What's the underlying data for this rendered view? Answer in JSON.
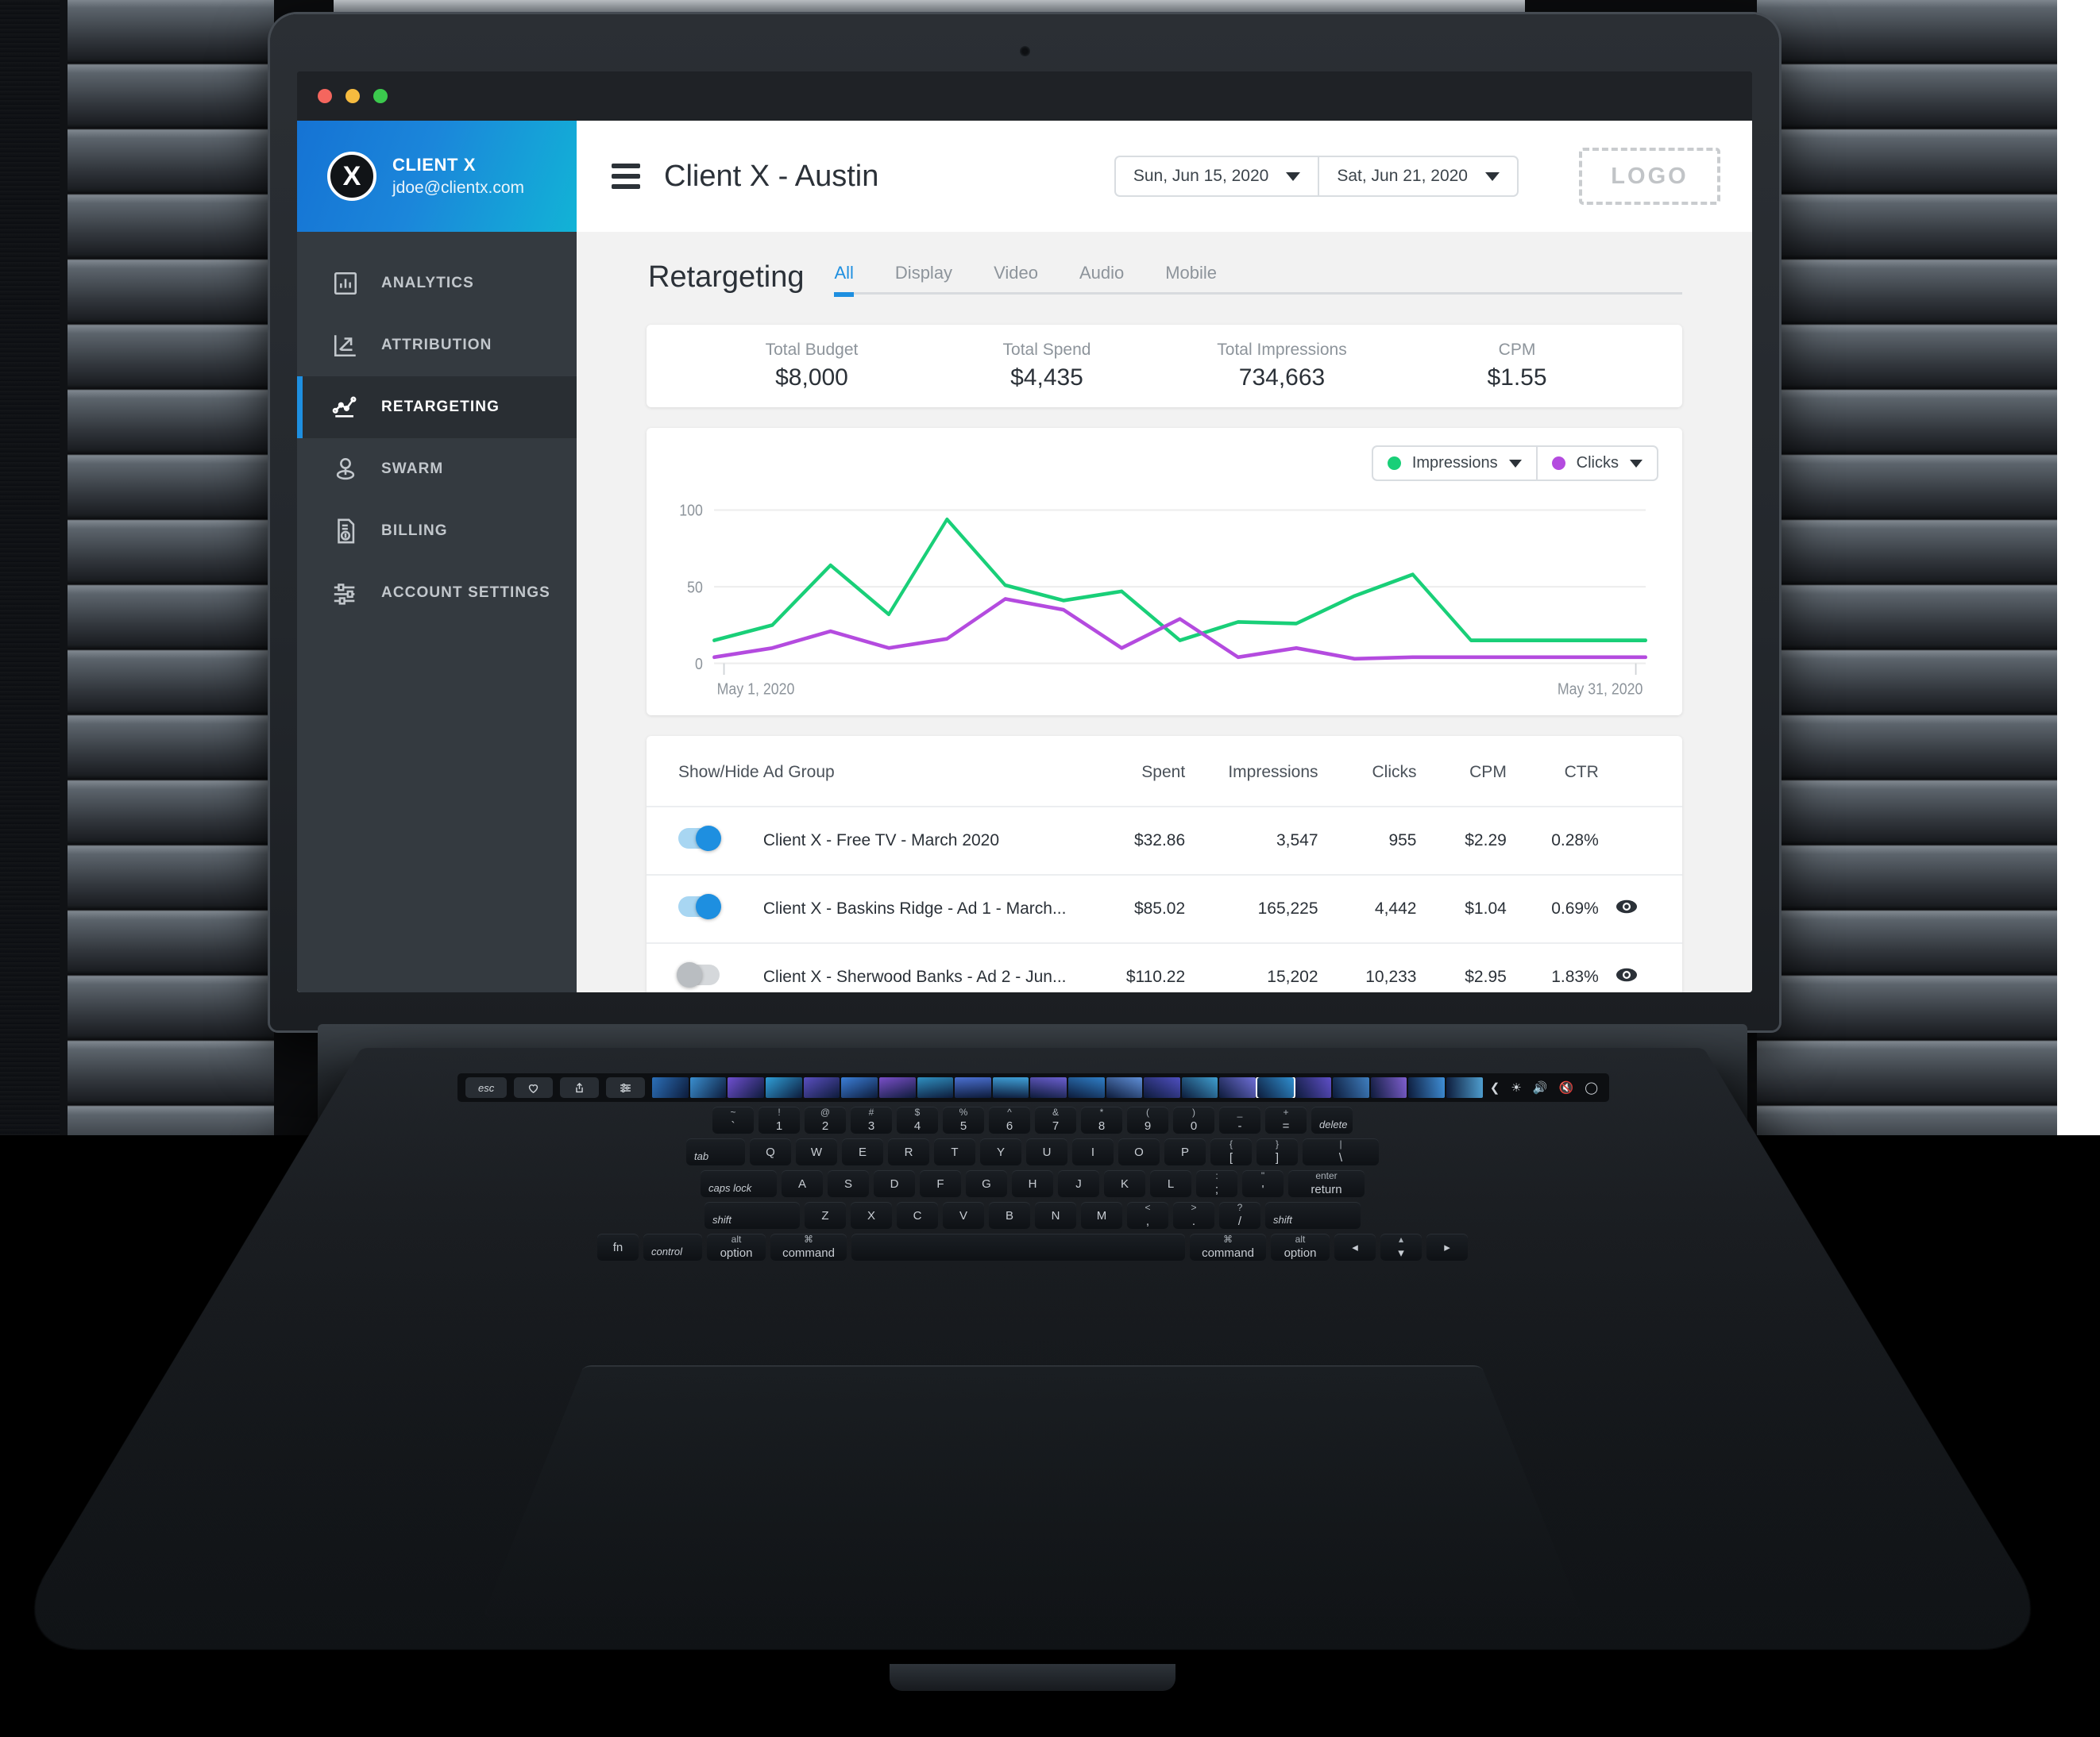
{
  "window": {
    "traffic_lights": [
      "close",
      "minimize",
      "maximize"
    ]
  },
  "sidebar": {
    "brand": {
      "mark_letter": "X",
      "name": "CLIENT X",
      "email": "jdoe@clientx.com"
    },
    "items": [
      {
        "label": "ANALYTICS",
        "icon": "bar-chart-icon",
        "active": false
      },
      {
        "label": "ATTRIBUTION",
        "icon": "attribution-arrow-icon",
        "active": false
      },
      {
        "label": "RETARGETING",
        "icon": "line-chart-icon",
        "active": true
      },
      {
        "label": "SWARM",
        "icon": "map-pin-icon",
        "active": false
      },
      {
        "label": "BILLING",
        "icon": "invoice-dollar-icon",
        "active": false
      },
      {
        "label": "ACCOUNT SETTINGS",
        "icon": "sliders-icon",
        "active": false
      }
    ]
  },
  "topbar": {
    "menu_icon": "hamburger-icon",
    "title": "Client X - Austin",
    "date_start": "Sun, Jun 15, 2020",
    "date_end": "Sat, Jun 21, 2020",
    "logo_placeholder": "LOGO"
  },
  "section": {
    "title": "Retargeting",
    "tabs": [
      {
        "label": "All",
        "active": true
      },
      {
        "label": "Display",
        "active": false
      },
      {
        "label": "Video",
        "active": false
      },
      {
        "label": "Audio",
        "active": false
      },
      {
        "label": "Mobile",
        "active": false
      }
    ]
  },
  "kpis": [
    {
      "label": "Total Budget",
      "value": "$8,000"
    },
    {
      "label": "Total Spend",
      "value": "$4,435"
    },
    {
      "label": "Total Impressions",
      "value": "734,663"
    },
    {
      "label": "CPM",
      "value": "$1.55"
    }
  ],
  "chart_legend": [
    {
      "label": "Impressions",
      "color": "#19cf78"
    },
    {
      "label": "Clicks",
      "color": "#b44bdf"
    }
  ],
  "chart_data": {
    "type": "line",
    "title": "",
    "xlabel": "",
    "ylabel": "",
    "ylim": [
      0,
      110
    ],
    "yticks": [
      0,
      50,
      100
    ],
    "ytick_labels": [
      "0",
      "50",
      "100"
    ],
    "grid": true,
    "legend_position": "top-right",
    "x_axis_start_label": "May 1, 2020",
    "x_axis_end_label": "May 31, 2020",
    "x": [
      1,
      2,
      3,
      4,
      5,
      6,
      7,
      8,
      9,
      10,
      11,
      12,
      13,
      14,
      15,
      16,
      17
    ],
    "series": [
      {
        "name": "Impressions",
        "color": "#19cf78",
        "values": [
          15,
          25,
          64,
          32,
          94,
          51,
          41,
          47,
          15,
          27,
          26,
          44,
          58,
          15,
          15,
          15,
          15
        ]
      },
      {
        "name": "Clicks",
        "color": "#b44bdf",
        "values": [
          4,
          10,
          21,
          10,
          16,
          42,
          35,
          10,
          29,
          4,
          10,
          3,
          4,
          4,
          4,
          4,
          4
        ]
      }
    ]
  },
  "table": {
    "columns": [
      "Show/Hide",
      "Ad Group",
      "Spent",
      "Impressions",
      "Clicks",
      "CPM",
      "CTR",
      ""
    ],
    "rows": [
      {
        "toggle": "on",
        "name": "Client X - Free TV - March 2020",
        "spent": "$32.86",
        "impressions": "3,547",
        "clicks": "955",
        "cpm": "$2.29",
        "ctr": "0.28%",
        "eye": false
      },
      {
        "toggle": "on",
        "name": "Client X - Baskins Ridge - Ad 1 - March...",
        "spent": "$85.02",
        "impressions": "165,225",
        "clicks": "4,442",
        "cpm": "$1.04",
        "ctr": "0.69%",
        "eye": true
      },
      {
        "toggle": "off",
        "name": "Client X - Sherwood Banks - Ad 2 - Jun...",
        "spent": "$110.22",
        "impressions": "15,202",
        "clicks": "10,233",
        "cpm": "$2.95",
        "ctr": "1.83%",
        "eye": true
      }
    ]
  },
  "keyboard": {
    "touchbar": {
      "esc": "esc",
      "keys": [
        "heart-icon",
        "share-icon",
        "sliders-icon"
      ],
      "right_icons": [
        "prev-icon",
        "brightness-icon",
        "volume-icon",
        "mute-icon",
        "siri-icon"
      ]
    },
    "rows": [
      [
        {
          "top": "~",
          "bottom": "`"
        },
        {
          "top": "!",
          "bottom": "1"
        },
        {
          "top": "@",
          "bottom": "2"
        },
        {
          "top": "#",
          "bottom": "3"
        },
        {
          "top": "$",
          "bottom": "4"
        },
        {
          "top": "%",
          "bottom": "5"
        },
        {
          "top": "^",
          "bottom": "6"
        },
        {
          "top": "&",
          "bottom": "7"
        },
        {
          "top": "*",
          "bottom": "8"
        },
        {
          "top": "(",
          "bottom": "9"
        },
        {
          "top": ")",
          "bottom": "0"
        },
        {
          "top": "_",
          "bottom": "-"
        },
        {
          "top": "+",
          "bottom": "="
        },
        {
          "top": "",
          "bottom": "delete"
        }
      ],
      [
        {
          "top": "",
          "bottom": "tab"
        },
        {
          "top": "",
          "bottom": "Q"
        },
        {
          "top": "",
          "bottom": "W"
        },
        {
          "top": "",
          "bottom": "E"
        },
        {
          "top": "",
          "bottom": "R"
        },
        {
          "top": "",
          "bottom": "T"
        },
        {
          "top": "",
          "bottom": "Y"
        },
        {
          "top": "",
          "bottom": "U"
        },
        {
          "top": "",
          "bottom": "I"
        },
        {
          "top": "",
          "bottom": "O"
        },
        {
          "top": "",
          "bottom": "P"
        },
        {
          "top": "{",
          "bottom": "["
        },
        {
          "top": "}",
          "bottom": "]"
        },
        {
          "top": "|",
          "bottom": "\\"
        }
      ],
      [
        {
          "top": "",
          "bottom": "caps lock"
        },
        {
          "top": "",
          "bottom": "A"
        },
        {
          "top": "",
          "bottom": "S"
        },
        {
          "top": "",
          "bottom": "D"
        },
        {
          "top": "",
          "bottom": "F"
        },
        {
          "top": "",
          "bottom": "G"
        },
        {
          "top": "",
          "bottom": "H"
        },
        {
          "top": "",
          "bottom": "J"
        },
        {
          "top": "",
          "bottom": "K"
        },
        {
          "top": "",
          "bottom": "L"
        },
        {
          "top": ":",
          "bottom": ";"
        },
        {
          "top": "\"",
          "bottom": "'"
        },
        {
          "top": "enter",
          "bottom": "return"
        }
      ],
      [
        {
          "top": "",
          "bottom": "shift"
        },
        {
          "top": "",
          "bottom": "Z"
        },
        {
          "top": "",
          "bottom": "X"
        },
        {
          "top": "",
          "bottom": "C"
        },
        {
          "top": "",
          "bottom": "V"
        },
        {
          "top": "",
          "bottom": "B"
        },
        {
          "top": "",
          "bottom": "N"
        },
        {
          "top": "",
          "bottom": "M"
        },
        {
          "top": "<",
          "bottom": ","
        },
        {
          "top": ">",
          "bottom": "."
        },
        {
          "top": "?",
          "bottom": "/"
        },
        {
          "top": "",
          "bottom": "shift"
        }
      ],
      [
        {
          "top": "",
          "bottom": "fn"
        },
        {
          "top": "",
          "bottom": "control"
        },
        {
          "top": "alt",
          "bottom": "option"
        },
        {
          "top": "⌘",
          "bottom": "command"
        },
        {
          "top": "",
          "bottom": ""
        },
        {
          "top": "⌘",
          "bottom": "command"
        },
        {
          "top": "alt",
          "bottom": "option"
        },
        {
          "top": "",
          "bottom": "◂"
        },
        {
          "top": "▴",
          "bottom": "▾"
        },
        {
          "top": "",
          "bottom": "▸"
        }
      ]
    ]
  }
}
